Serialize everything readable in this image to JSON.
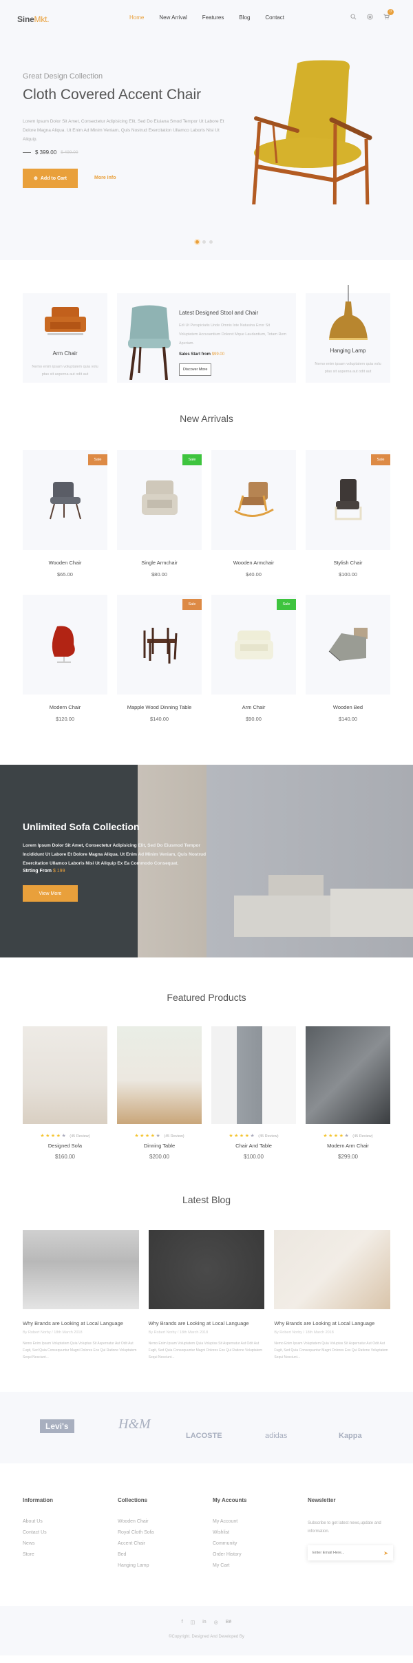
{
  "header": {
    "logo_main": "Sine",
    "logo_accent": "Mkt.",
    "menu": [
      {
        "label": "Home",
        "active": true
      },
      {
        "label": "New Arrival"
      },
      {
        "label": "Features"
      },
      {
        "label": "Blog"
      },
      {
        "label": "Contact"
      }
    ],
    "cart_count": "0",
    "icons": [
      "search-icon",
      "settings-icon",
      "cart-icon"
    ],
    "accent_color": "#e9a03b"
  },
  "hero": {
    "subtitle": "Great Design Collection",
    "title": "Cloth Covered Accent Chair",
    "description": "Lorem Ipsum Dolor Sit Amet, Consectetur Adipisicing Elit, Sed Do Eiuiana Smod Tempor Ut Labore Et Dolore Magna Aliqua. Ut Enim Ad Minim Veniam, Quis Nostrud Exercitation Ullamco Laboris Nisi Ut Aliquip.",
    "price": "$ 399.00",
    "old_price": "$ 499.00",
    "add_to_cart": "Add to Cart",
    "more_info": "More Info",
    "slides": 3,
    "active_slide": 1
  },
  "categories": {
    "left": {
      "title": "Arm Chair",
      "desc": "Nemo enim ipsam voluptatem quia volu ptas sit asperna aut odit aut"
    },
    "center": {
      "title": "Latest Designed Stool and Chair",
      "desc": "Edi Ut Perspiciatis Unde Omnis Iste Natusina Error Sit Voluptatem Accusantium Doloret Mque Laudantium, Totam Rem Aperiam.",
      "sales_label": "Sales Start from",
      "sales_price": "$99.00",
      "button": "Discover More"
    },
    "right": {
      "title": "Hanging Lamp",
      "desc": "Nemo enim ipsam voluptatem quia volu ptas sit asperna aut odit aut"
    }
  },
  "new_arrivals": {
    "title": "New Arrivals",
    "items": [
      {
        "name": "Wooden Chair",
        "price": "$65.00",
        "badge": "Sale",
        "badge_color": "orange"
      },
      {
        "name": "Single Armchair",
        "price": "$80.00",
        "badge": "Sale",
        "badge_color": "green"
      },
      {
        "name": "Wooden Armchair",
        "price": "$40.00"
      },
      {
        "name": "Stylish Chair",
        "price": "$100.00",
        "badge": "Sale",
        "badge_color": "orange"
      },
      {
        "name": "Modern Chair",
        "price": "$120.00"
      },
      {
        "name": "Mapple Wood Dinning Table",
        "price": "$140.00",
        "badge": "Sale",
        "badge_color": "orange"
      },
      {
        "name": "Arm Chair",
        "price": "$90.00",
        "badge": "Sale",
        "badge_color": "green"
      },
      {
        "name": "Wooden Bed",
        "price": "$140.00"
      }
    ]
  },
  "banner": {
    "title": "Unlimited Sofa Collection",
    "description": "Lorem Ipsum Dolor Sit Amet, Consectetur Adipisicing Elit, Sed Do Eiusmod Tempor Incididunt Ut Labore Et Dolore Magna Aliqua. Ut Enim Ad Minim Veniam, Quis Nostrud Exercitation Ullamco Laboris Nisi Ut Aliquip Ex Ea Commodo Consequat.",
    "from_label": "Strting From",
    "from_price": "$ 199",
    "button": "View More"
  },
  "featured": {
    "title": "Featured Products",
    "items": [
      {
        "name": "Designed Sofa",
        "price": "$160.00",
        "rating": 4,
        "reviews": "(45 Review)"
      },
      {
        "name": "Dinning Table",
        "price": "$200.00",
        "rating": 4,
        "reviews": "(45 Review)"
      },
      {
        "name": "Chair And Table",
        "price": "$100.00",
        "rating": 4,
        "reviews": "(45 Review)"
      },
      {
        "name": "Modern Arm Chair",
        "price": "$299.00",
        "rating": 4,
        "reviews": "(45 Review)"
      }
    ]
  },
  "blog": {
    "title": "Latest Blog",
    "posts": [
      {
        "title": "Why Brands are Looking at Local Language",
        "meta": "By Robert Norby / 18th March 2018",
        "excerpt": "Nemo Enim Ipsam Voluptatem Quia Voluptas Sit Aspernatur Aut Odit Aut Fugit, Sed Quia Consequuntur Magni Dolores Eos Qui Ratione Voluptatem Sequi Nesciunt..."
      },
      {
        "title": "Why Brands are Looking at Local Language",
        "meta": "By Robert Norby / 18th March 2018",
        "excerpt": "Nemo Enim Ipsam Voluptatem Quia Voluptas Sit Aspernatur Aut Odit Aut Fugit, Sed Quia Consequuntur Magni Dolores Eos Qui Ratione Voluptatem Sequi Nesciunt..."
      },
      {
        "title": "Why Brands are Looking at Local Language",
        "meta": "By Robert Norby / 18th March 2018",
        "excerpt": "Nemo Enim Ipsam Voluptatem Quia Voluptas Sit Aspernatur Aut Odit Aut Fugit, Sed Quia Consequuntur Magni Dolores Eos Qui Ratione Voluptatem Sequi Nesciunt..."
      }
    ]
  },
  "brands": [
    "Levi's",
    "H&M",
    "LACOSTE",
    "adidas",
    "Kappa"
  ],
  "footer": {
    "columns": [
      {
        "title": "Information",
        "links": [
          "About Us",
          "Contact Us",
          "News",
          "Store"
        ]
      },
      {
        "title": "Collections",
        "links": [
          "Wooden Chair",
          "Royal Cloth Sofa",
          "Accent Chair",
          "Bed",
          "Hanging Lamp"
        ]
      },
      {
        "title": "My Accounts",
        "links": [
          "My Account",
          "Wishlist",
          "Community",
          "Order History",
          "My Cart"
        ]
      }
    ],
    "newsletter": {
      "title": "Newsletter",
      "text": "Subscribe to get latest news,update and information.",
      "placeholder": "Enter Email Here..."
    },
    "social": [
      "f",
      "◫",
      "in",
      "◎",
      "Bē"
    ],
    "copyright": "©Copyright. Designed And Developed By"
  }
}
